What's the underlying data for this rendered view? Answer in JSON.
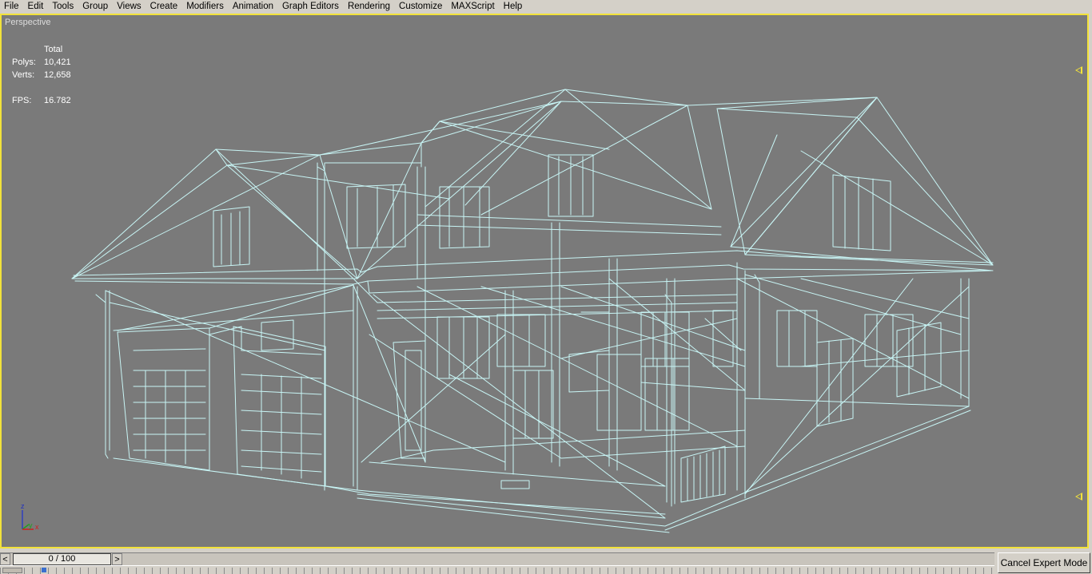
{
  "menubar": {
    "items": [
      "File",
      "Edit",
      "Tools",
      "Group",
      "Views",
      "Create",
      "Modifiers",
      "Animation",
      "Graph Editors",
      "Rendering",
      "Customize",
      "MAXScript",
      "Help"
    ]
  },
  "viewport": {
    "label": "Perspective",
    "wire_color": "#c8f5f5",
    "border_color": "#f2e23a",
    "background_color": "#7a7a7a",
    "stats": {
      "header": "Total",
      "polys_label": "Polys:",
      "polys": "10,421",
      "verts_label": "Verts:",
      "verts": "12,658",
      "fps_label": "FPS:",
      "fps": "16.782"
    },
    "axis": {
      "z": "z",
      "y": "y",
      "x": "x"
    }
  },
  "timeline": {
    "frame_display": "0 / 100",
    "prev_glyph": "<",
    "next_glyph": ">"
  },
  "cancel_expert_label": "Cancel Expert Mode"
}
